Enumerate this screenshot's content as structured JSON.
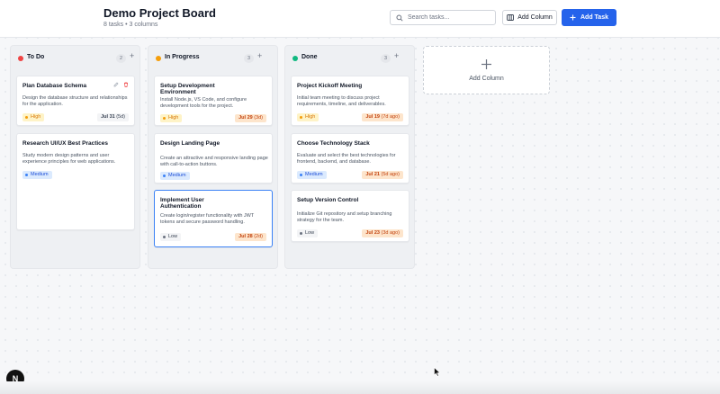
{
  "header": {
    "title": "Demo Project Board",
    "subtitle": "8 tasks • 3 columns",
    "search_placeholder": "Search tasks...",
    "add_column_label": "Add Column",
    "add_task_label": "Add Task"
  },
  "colors": {
    "accent": "#2563eb",
    "todo": "#ef4444",
    "in_progress": "#f59e0b",
    "done": "#10b981",
    "high": "#f59e0b",
    "medium": "#3b82f6",
    "low": "#6b7280"
  },
  "columns": [
    {
      "title": "To Do",
      "count": "2",
      "cards": [
        {
          "title": "Plan Database Schema",
          "description": "Design the database structure and relationships for the application.",
          "priority": "High",
          "due": "Jul 31",
          "due_relative": "(5d)"
        },
        {
          "title": "Research UI/UX Best Practices",
          "description": "Study modern design patterns and user experience principles for web applications.",
          "priority": "Medium"
        }
      ]
    },
    {
      "title": "In Progress",
      "count": "3",
      "cards": [
        {
          "title": "Setup Development Environment",
          "description": "Install Node.js, VS Code, and configure development tools for the project.",
          "priority": "High",
          "due": "Jul 29",
          "due_relative": "(3d)"
        },
        {
          "title": "Design Landing Page",
          "description": "Create an attractive and responsive landing page with call-to-action buttons.",
          "priority": "Medium"
        },
        {
          "title": "Implement User Authentication",
          "description": "Create login/register functionality with JWT tokens and secure password handling.",
          "priority": "Low",
          "due": "Jul 28",
          "due_relative": "(2d)"
        }
      ]
    },
    {
      "title": "Done",
      "count": "3",
      "cards": [
        {
          "title": "Project Kickoff Meeting",
          "description": "Initial team meeting to discuss project requirements, timeline, and deliverables.",
          "priority": "High",
          "due": "Jul 19",
          "due_relative": "(7d ago)"
        },
        {
          "title": "Choose Technology Stack",
          "description": "Evaluate and select the best technologies for frontend, backend, and database.",
          "priority": "Medium",
          "due": "Jul 21",
          "due_relative": "(5d ago)"
        },
        {
          "title": "Setup Version Control",
          "description": "Initialize Git repository and setup branching strategy for the team.",
          "priority": "Low",
          "due": "Jul 23",
          "due_relative": "(3d ago)"
        }
      ]
    }
  ],
  "add_column_tile": {
    "label": "Add Column"
  },
  "badge_logo": "N"
}
